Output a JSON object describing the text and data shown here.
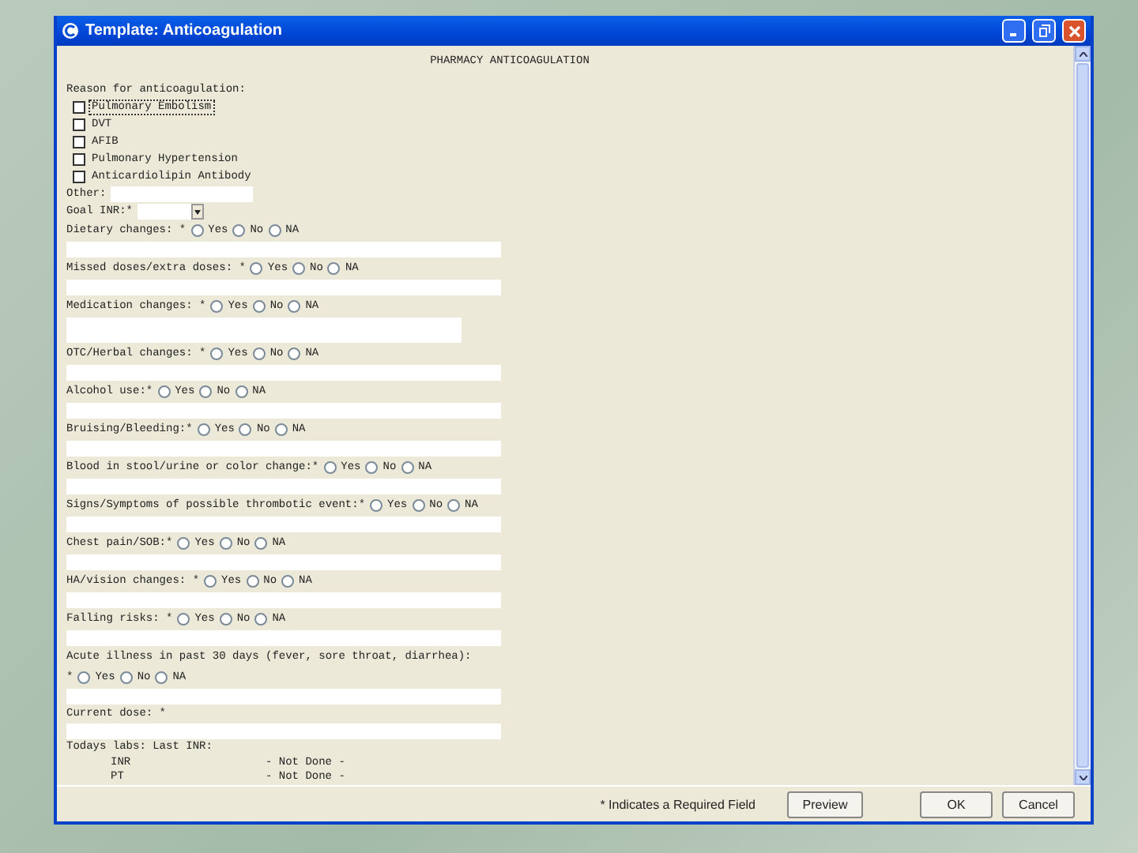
{
  "window": {
    "title": "Template: Anticoagulation"
  },
  "form": {
    "heading": "PHARMACY ANTICOAGULATION",
    "reason": {
      "label": "Reason for anticoagulation:",
      "options": [
        {
          "label": "Pulmonary Embolism",
          "checked": false,
          "focused": true
        },
        {
          "label": "DVT",
          "checked": false,
          "focused": false
        },
        {
          "label": "AFIB",
          "checked": false,
          "focused": false
        },
        {
          "label": "Pulmonary Hypertension",
          "checked": false,
          "focused": false
        },
        {
          "label": "Anticardiolipin Antibody",
          "checked": false,
          "focused": false
        }
      ]
    },
    "other": {
      "label": "Other:"
    },
    "goal_inr": {
      "label": "Goal INR:*"
    },
    "questions": [
      {
        "label": "Dietary changes: *",
        "tall": false,
        "options": [
          {
            "label": "Yes",
            "selected": false
          },
          {
            "label": "No",
            "selected": false
          },
          {
            "label": "NA",
            "selected": false
          }
        ]
      },
      {
        "label": "Missed doses/extra doses: *",
        "tall": false,
        "options": [
          {
            "label": "Yes",
            "selected": false
          },
          {
            "label": "No",
            "selected": false
          },
          {
            "label": "NA",
            "selected": false
          }
        ]
      },
      {
        "label": "Medication changes: *",
        "tall": true,
        "options": [
          {
            "label": "Yes",
            "selected": false
          },
          {
            "label": "No",
            "selected": false
          },
          {
            "label": "NA",
            "selected": false
          }
        ]
      },
      {
        "label": "OTC/Herbal changes: *",
        "tall": false,
        "options": [
          {
            "label": "Yes",
            "selected": false
          },
          {
            "label": "No",
            "selected": false
          },
          {
            "label": "NA",
            "selected": false
          }
        ]
      },
      {
        "label": "Alcohol use:*",
        "tall": false,
        "options": [
          {
            "label": "Yes",
            "selected": false
          },
          {
            "label": "No",
            "selected": false
          },
          {
            "label": "NA",
            "selected": false
          }
        ]
      },
      {
        "label": "Bruising/Bleeding:*",
        "tall": false,
        "options": [
          {
            "label": "Yes",
            "selected": false
          },
          {
            "label": "No",
            "selected": false
          },
          {
            "label": "NA",
            "selected": false
          }
        ]
      },
      {
        "label": "Blood in stool/urine or color change:*",
        "tall": false,
        "options": [
          {
            "label": "Yes",
            "selected": false
          },
          {
            "label": "No",
            "selected": false
          },
          {
            "label": "NA",
            "selected": false
          }
        ]
      },
      {
        "label": "Signs/Symptoms of possible thrombotic event:*",
        "tall": false,
        "options": [
          {
            "label": "Yes",
            "selected": false
          },
          {
            "label": "No",
            "selected": false
          },
          {
            "label": "NA",
            "selected": false
          }
        ]
      },
      {
        "label": "Chest pain/SOB:*",
        "tall": false,
        "options": [
          {
            "label": "Yes",
            "selected": false
          },
          {
            "label": "No",
            "selected": false
          },
          {
            "label": "NA",
            "selected": false
          }
        ]
      },
      {
        "label": "HA/vision changes: *",
        "tall": false,
        "options": [
          {
            "label": "Yes",
            "selected": false
          },
          {
            "label": "No",
            "selected": false
          },
          {
            "label": "NA",
            "selected": false
          }
        ]
      },
      {
        "label": "Falling risks: *",
        "tall": false,
        "options": [
          {
            "label": "Yes",
            "selected": false
          },
          {
            "label": "No",
            "selected": false
          },
          {
            "label": "NA",
            "selected": false
          }
        ]
      },
      {
        "label": "Acute illness in past 30 days (fever, sore throat, diarrhea):",
        "second_line_mark": "*",
        "tall": false,
        "options": [
          {
            "label": "Yes",
            "selected": false
          },
          {
            "label": "No",
            "selected": false
          },
          {
            "label": "NA",
            "selected": false
          }
        ]
      }
    ],
    "current_dose": {
      "label": "Current dose: *"
    },
    "labs": {
      "label": "Todays labs: Last INR:",
      "rows": [
        {
          "name": "INR",
          "value": "- Not Done -"
        },
        {
          "name": "PT",
          "value": "- Not Done -"
        }
      ]
    }
  },
  "footer": {
    "note": "* Indicates a Required Field",
    "buttons": [
      "Preview",
      "OK",
      "Cancel"
    ]
  }
}
